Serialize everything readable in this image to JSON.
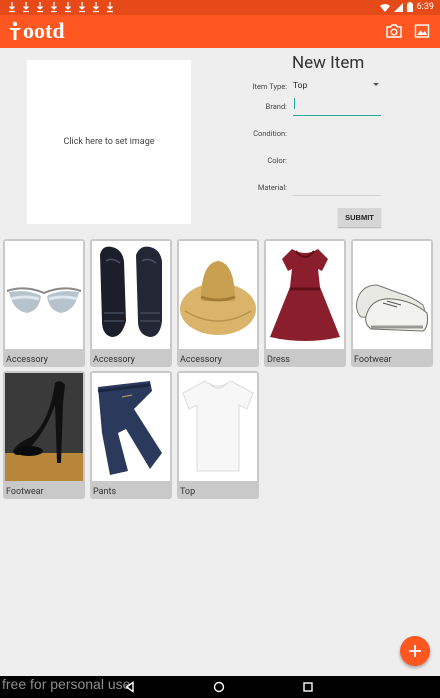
{
  "status_bar": {
    "time": "6:39",
    "download_icons": [
      "download-icon",
      "download-icon",
      "download-icon",
      "download-icon",
      "download-icon",
      "download-icon",
      "download-icon",
      "download-icon"
    ]
  },
  "app_bar": {
    "title": "ootd",
    "background": "#ff5722",
    "status_background": "#e64a19"
  },
  "form": {
    "title": "New Item",
    "image_placeholder": "Click here to set image",
    "item_type_label": "Item Type:",
    "item_type_value": "Top",
    "brand_label": "Brand:",
    "brand_value": "",
    "condition_label": "Condition:",
    "condition_value": "",
    "color_label": "Color:",
    "color_value": "",
    "material_label": "Material:",
    "material_value": "",
    "submit_label": "SUBMIT"
  },
  "items": [
    {
      "label": "Accessory",
      "icon": "sunglasses"
    },
    {
      "label": "Accessory",
      "icon": "gloves"
    },
    {
      "label": "Accessory",
      "icon": "straw-hat"
    },
    {
      "label": "Dress",
      "icon": "dress"
    },
    {
      "label": "Footwear",
      "icon": "sneakers"
    },
    {
      "label": "Footwear",
      "icon": "high-heel"
    },
    {
      "label": "Pants",
      "icon": "jeans"
    },
    {
      "label": "Top",
      "icon": "t-shirt"
    }
  ],
  "watermark": "free for personal use",
  "accent": "#26a69a"
}
